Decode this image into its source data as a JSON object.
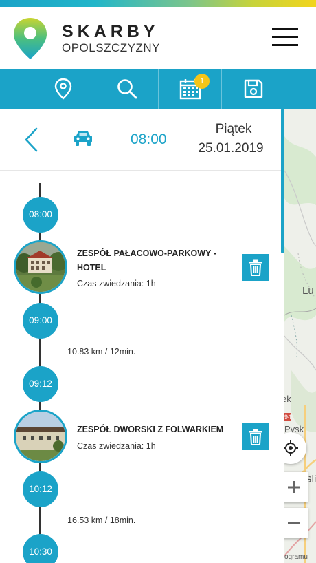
{
  "brand": {
    "line1": "SKARBY",
    "line2": "OPOLSZCZYZNY"
  },
  "toolbar": {
    "icons": [
      "location-pin-icon",
      "search-icon",
      "calendar-icon",
      "save-icon"
    ],
    "calendar_badge": "1"
  },
  "trip": {
    "time": "08:00",
    "day": "Piątek",
    "date": "25.01.2019",
    "mode_icon": "car-icon"
  },
  "timeline": {
    "t1": "08:00",
    "poi1": {
      "title": "ZESPÓŁ PAŁACOWO-PARKOWY - HOTEL",
      "visit": "Czas zwiedzania: 1h"
    },
    "t2": "09:00",
    "leg1": "10.83 km / 12min.",
    "t3": "09:12",
    "poi2": {
      "title": "ZESPÓŁ DWORSKI Z FOLWARKIEM",
      "visit": "Czas zwiedzania: 1h"
    },
    "t4": "10:12",
    "leg2": "16.53 km / 18min.",
    "t5": "10:30"
  },
  "map": {
    "labels": [
      "Lu",
      "ek",
      "Pysk",
      "Gli",
      "ogramu"
    ],
    "road_marker": "94"
  },
  "colors": {
    "accent": "#1ba3c8",
    "badge": "#f5c518"
  }
}
